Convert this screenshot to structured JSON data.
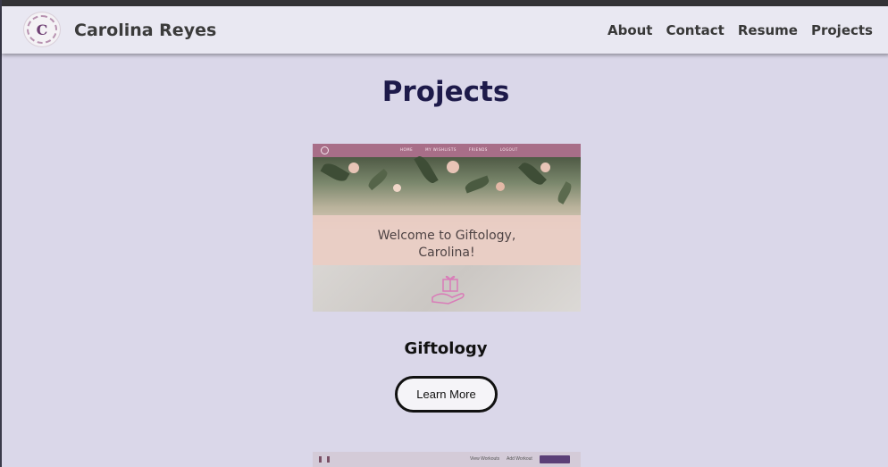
{
  "header": {
    "brand": "Carolina Reyes",
    "logo_letter": "C",
    "nav": [
      "About",
      "Contact",
      "Resume",
      "Projects"
    ]
  },
  "main": {
    "title": "Projects",
    "projects": [
      {
        "screenshot": {
          "nav_links": [
            "HOME",
            "MY WISHLISTS",
            "FRIENDS",
            "LOGOUT"
          ],
          "welcome_line1": "Welcome to Giftology,",
          "welcome_line2": "Carolina!"
        },
        "name": "Giftology",
        "button": "Learn More"
      },
      {
        "screenshot": {
          "nav_links": [
            "View Workouts",
            "Add Workout"
          ],
          "button": "LOGOUT"
        }
      }
    ]
  },
  "colors": {
    "page_bg": "#dad7e9",
    "navbar_bg": "#e9e8f2",
    "title": "#1d1a4a"
  }
}
